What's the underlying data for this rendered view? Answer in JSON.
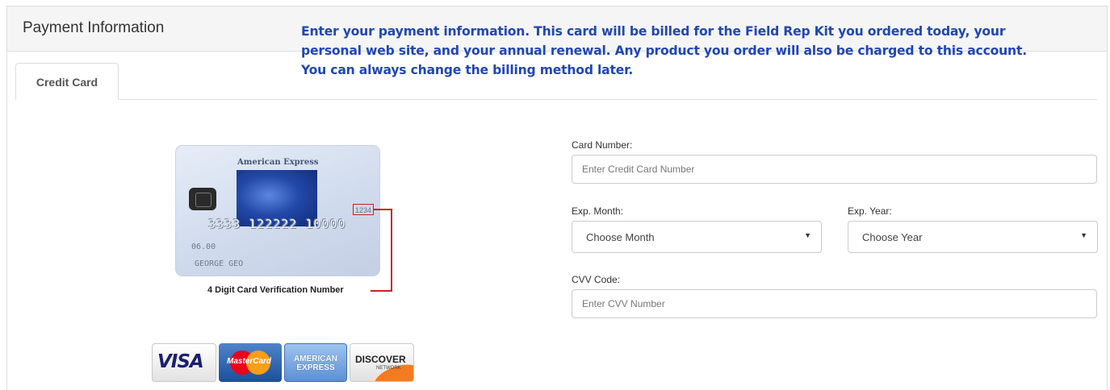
{
  "panel": {
    "title": "Payment Information",
    "notice": "Enter your payment information. This card will be billed for the Field Rep Kit you ordered today, your personal web site, and your annual renewal.  Any product you order will also be charged to this account. You can always change the billing method later."
  },
  "tabs": [
    {
      "label": "Credit Card",
      "active": true
    }
  ],
  "card_image": {
    "brand": "American Express",
    "number": "3333 122222 10000",
    "expiry": "06.00",
    "holder": "GEORGE GEO",
    "cvv_sample": "1234",
    "caption": "4 Digit Card Verification Number"
  },
  "card_logos": {
    "visa": "VISA",
    "mastercard": "MasterCard",
    "amex": "AMERICAN EXPRESS",
    "discover": "DISCOVER",
    "discover_sub": "NETWORK"
  },
  "form": {
    "card_number": {
      "label": "Card Number:",
      "placeholder": "Enter Credit Card Number"
    },
    "exp_month": {
      "label": "Exp. Month:",
      "value": "Choose Month"
    },
    "exp_year": {
      "label": "Exp. Year:",
      "value": "Choose Year"
    },
    "cvv": {
      "label": "CVV Code:",
      "placeholder": "Enter CVV Number"
    }
  },
  "icons": {
    "select_caret": "▼"
  },
  "colors": {
    "notice_text": "#2147b3",
    "cvv_marker": "#d21f1f"
  }
}
